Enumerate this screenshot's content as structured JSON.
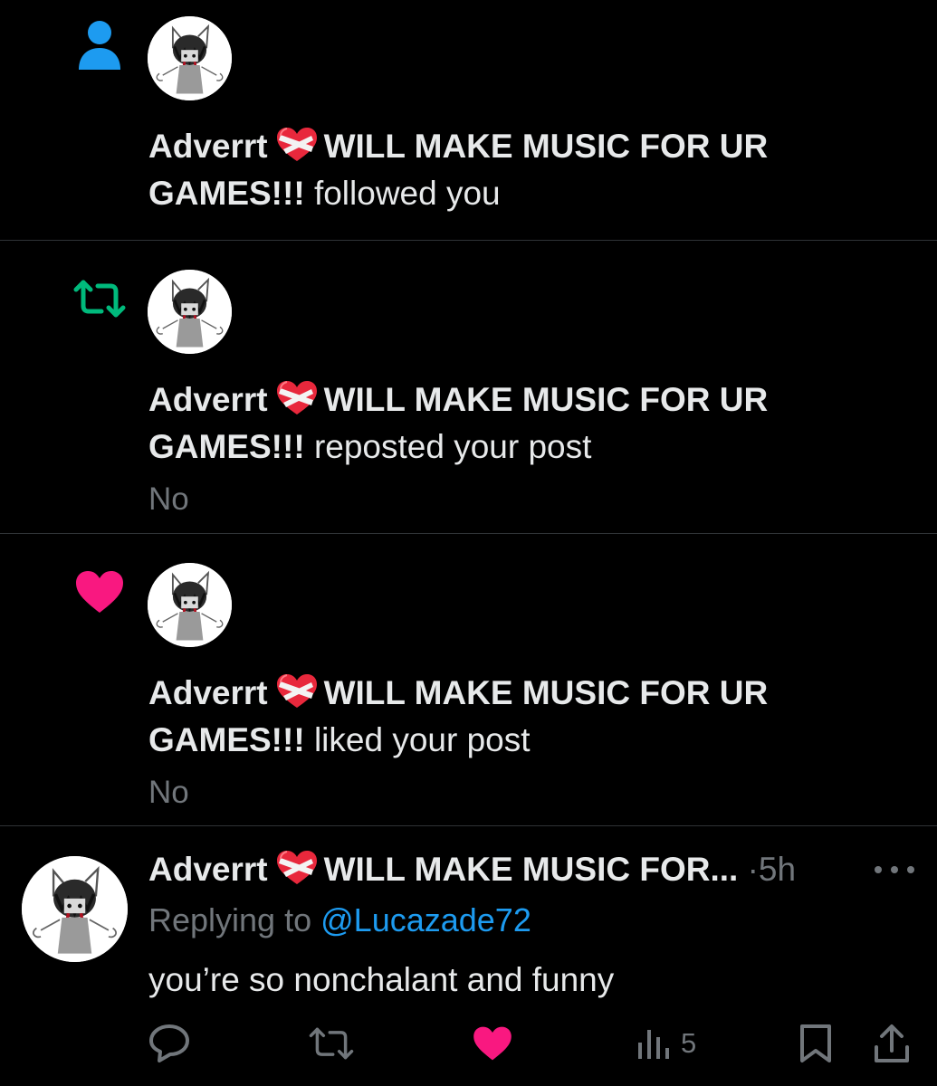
{
  "colors": {
    "follow_icon": "#1d9bf0",
    "repost_icon": "#00ba7c",
    "like_icon": "#f91880",
    "muted_text": "#71767b",
    "link": "#1d9bf0"
  },
  "notifications": [
    {
      "type": "follow",
      "icon": "person-icon",
      "name_part1": "Adverrt",
      "name_emoji": "heart-with-ribbon-emoji",
      "name_part2": "WILL MAKE MUSIC FOR UR GAMES!!!",
      "action": "followed you",
      "snippet": ""
    },
    {
      "type": "repost",
      "icon": "repost-icon",
      "name_part1": "Adverrt",
      "name_emoji": "heart-with-ribbon-emoji",
      "name_part2": "WILL MAKE MUSIC FOR UR GAMES!!!",
      "action": "reposted your post",
      "snippet": "No"
    },
    {
      "type": "like",
      "icon": "heart-icon",
      "name_part1": "Adverrt",
      "name_emoji": "heart-with-ribbon-emoji",
      "name_part2": "WILL MAKE MUSIC FOR UR GAMES!!!",
      "action": "liked your post",
      "snippet": "No"
    }
  ],
  "reply": {
    "name_part1": "Adverrt",
    "name_emoji": "heart-with-ribbon-emoji",
    "name_part2_truncated": "WILL MAKE MUSIC FOR...",
    "separator": "·",
    "time": "5h",
    "replying_prefix": "Replying to",
    "replying_handle": "@Lucazade72",
    "text": "you’re so nonchalant and funny",
    "actions": {
      "reply_icon": "comment-icon",
      "repost_icon": "repost-icon",
      "like_icon": "heart-icon",
      "liked": true,
      "views_icon": "bar-chart-icon",
      "views_count": "5",
      "bookmark_icon": "bookmark-icon",
      "share_icon": "share-icon"
    }
  }
}
